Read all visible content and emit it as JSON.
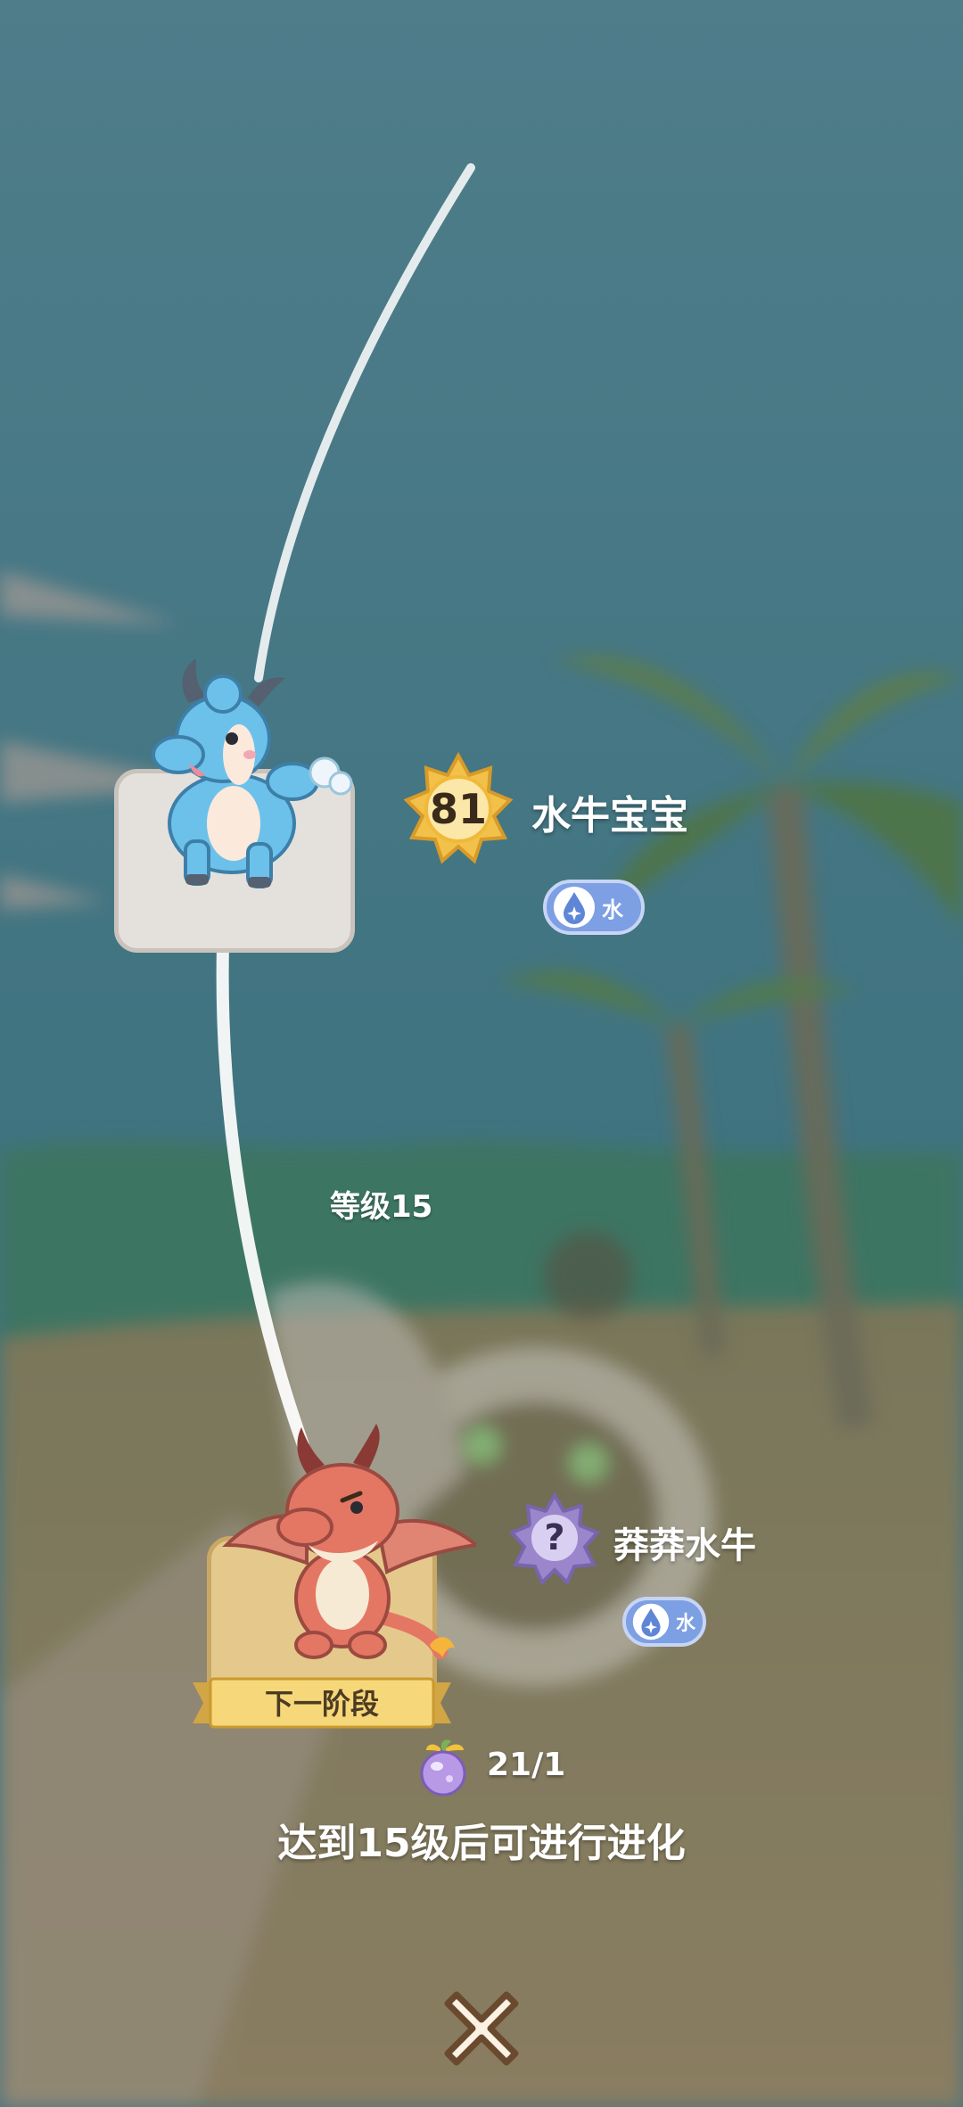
{
  "current_pet": {
    "level": "81",
    "name": "水牛宝宝",
    "type_label": "水",
    "image_icon": "baby-water-buffalo-icon"
  },
  "requirement": {
    "level_text": "等级15"
  },
  "next_pet": {
    "level": "?",
    "name": "莽莽水牛",
    "type_label": "水",
    "stage_label": "下一阶段",
    "image_icon": "red-dragon-icon"
  },
  "materials": {
    "icon": "evolution-fruit-icon",
    "count_text": "21/1"
  },
  "message": "达到15级后可进行进化",
  "colors": {
    "water_badge": "#7d9fe3",
    "level_gold": "#f2c14a",
    "unknown_purple": "#9b86cc"
  }
}
